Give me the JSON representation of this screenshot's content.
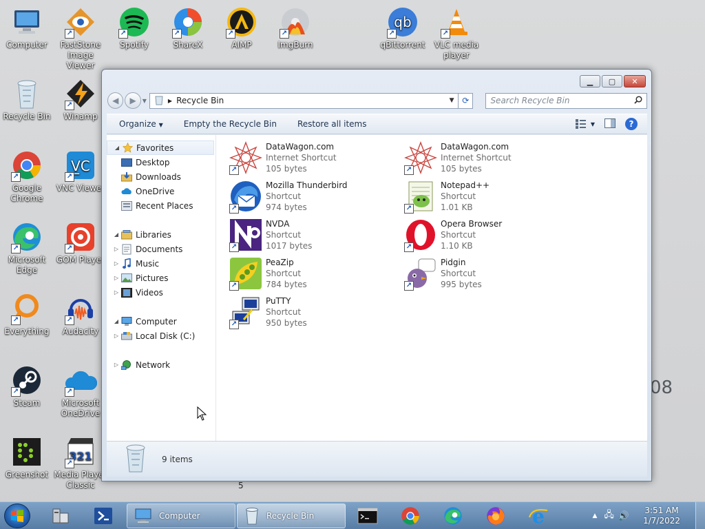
{
  "desktop": {
    "icons": [
      {
        "label": "Computer"
      },
      {
        "label": "FastStone Image Viewer"
      },
      {
        "label": "Spotify"
      },
      {
        "label": "ShareX"
      },
      {
        "label": "AIMP"
      },
      {
        "label": "ImgBurn"
      },
      {
        "label": "qBittorrent"
      },
      {
        "label": "VLC media player"
      },
      {
        "label": "Recycle Bin"
      },
      {
        "label": "Winamp"
      },
      {
        "label": "Google Chrome"
      },
      {
        "label": "VNC Viewer"
      },
      {
        "label": "Microsoft Edge"
      },
      {
        "label": "GOM Player"
      },
      {
        "label": "Everything"
      },
      {
        "label": "Audacity"
      },
      {
        "label": "Steam"
      },
      {
        "label": "Microsoft OneDrive"
      },
      {
        "label": "Greenshot"
      },
      {
        "label": "Media Player Classic"
      }
    ],
    "bg_text_08": "08",
    "bg_text_5": "5"
  },
  "window": {
    "address": {
      "location": "Recycle Bin"
    },
    "search": {
      "placeholder": "Search Recycle Bin"
    },
    "toolbar": {
      "organize": "Organize",
      "empty": "Empty the Recycle Bin",
      "restore": "Restore all items"
    },
    "nav": {
      "favorites": "Favorites",
      "desktop": "Desktop",
      "downloads": "Downloads",
      "onedrive": "OneDrive",
      "recent": "Recent Places",
      "libraries": "Libraries",
      "documents": "Documents",
      "music": "Music",
      "pictures": "Pictures",
      "videos": "Videos",
      "computer": "Computer",
      "local_disk": "Local Disk (C:)",
      "network": "Network"
    },
    "files": [
      {
        "name": "DataWagon.com",
        "type": "Internet Shortcut",
        "size": "105 bytes"
      },
      {
        "name": "DataWagon.com",
        "type": "Internet Shortcut",
        "size": "105 bytes"
      },
      {
        "name": "Mozilla Thunderbird",
        "type": "Shortcut",
        "size": "974 bytes"
      },
      {
        "name": "Notepad++",
        "type": "Shortcut",
        "size": "1.01 KB"
      },
      {
        "name": "NVDA",
        "type": "Shortcut",
        "size": "1017 bytes"
      },
      {
        "name": "Opera Browser",
        "type": "Shortcut",
        "size": "1.10 KB"
      },
      {
        "name": "PeaZip",
        "type": "Shortcut",
        "size": "784 bytes"
      },
      {
        "name": "Pidgin",
        "type": "Shortcut",
        "size": "995 bytes"
      },
      {
        "name": "PuTTY",
        "type": "Shortcut",
        "size": "950 bytes"
      }
    ],
    "status": {
      "count": "9 items"
    }
  },
  "taskbar": {
    "tasks": [
      {
        "label": "Computer"
      },
      {
        "label": "Recycle Bin"
      }
    ],
    "clock": {
      "time": "3:51 AM",
      "date": "1/7/2022"
    }
  },
  "colors": {
    "accent": "#2a6ad5",
    "taskbar": "#6f96c0",
    "close_button": "#c7463a"
  }
}
